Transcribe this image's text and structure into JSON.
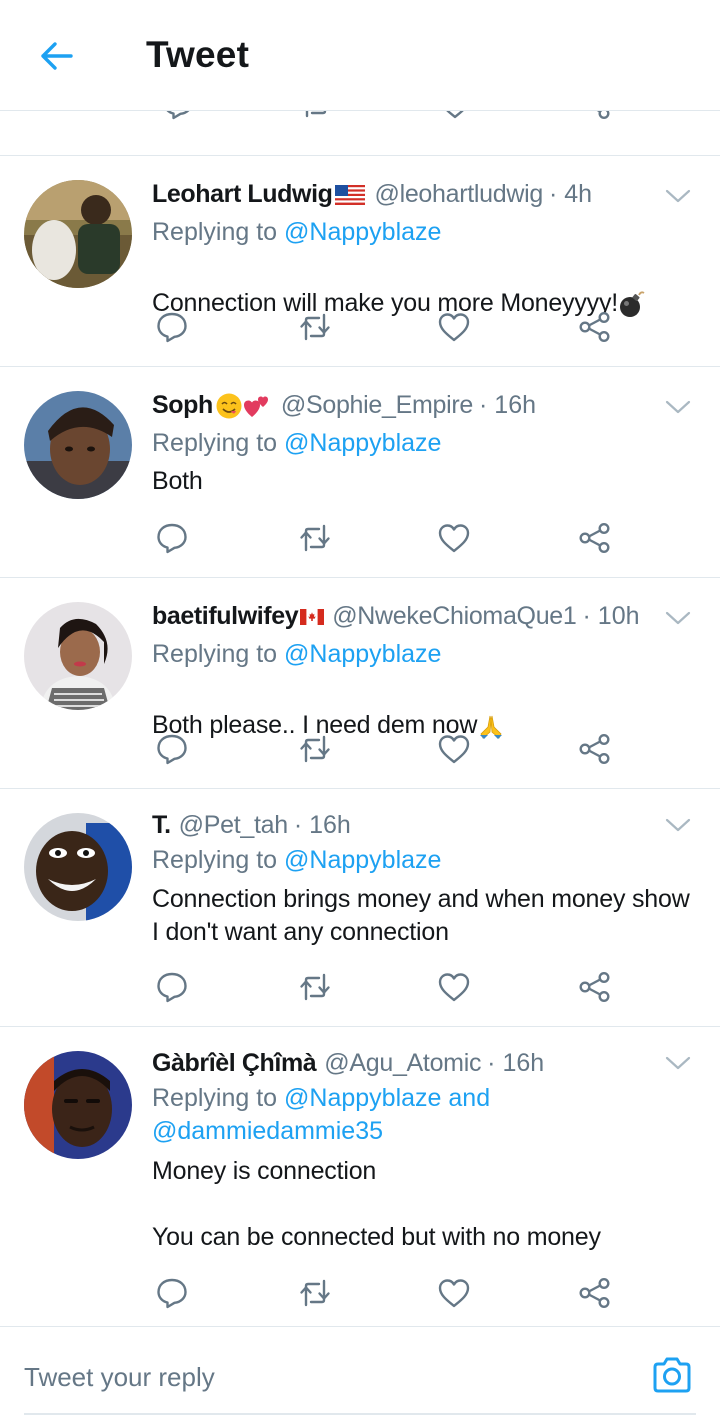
{
  "header": {
    "title": "Tweet",
    "back_icon": "arrow-left-icon"
  },
  "colors": {
    "accent": "#1da1f2",
    "secondary_text": "#657786",
    "divider": "#e1e8ed",
    "text": "#14171a"
  },
  "tweets": [
    {
      "name": "Leohart Ludwig",
      "name_icon": "us-flag",
      "handle": "@leohartludwig",
      "time": "· 4h",
      "replying_prefix": "Replying to ",
      "replying_to": "@Nappyblaze",
      "text": "Connection will make you more Moneyyyy!",
      "text_icon": "bomb-emoji"
    },
    {
      "name": "Soph",
      "name_icon": "yum-face-emoji two-hearts-emoji",
      "handle": "@Sophie_Empire",
      "time": "· 16h",
      "replying_prefix": "Replying to ",
      "replying_to": "@Nappyblaze",
      "text": "Both"
    },
    {
      "name": "baetifulwifey",
      "name_icon": "canada-flag",
      "handle": "@NwekeChiomaQue1",
      "time": "· 10h",
      "replying_prefix": "Replying to ",
      "replying_to": "@Nappyblaze",
      "text": "Both please.. I need dem now",
      "text_icon": "folded-hands-emoji"
    },
    {
      "name": "T.",
      "handle": "@Pet_tah",
      "time": "· 16h",
      "replying_prefix": "Replying to ",
      "replying_to": "@Nappyblaze",
      "text": "Connection brings money and when money show\nI don't want any connection"
    },
    {
      "name": "Gàbrîèl Çhîmà",
      "handle": "@Agu_Atomic",
      "time": "· 16h",
      "replying_prefix": "Replying to ",
      "replying_to": "@Nappyblaze and\n@dammiedammie35",
      "text": "Money is connection\n\nYou can be connected but with no money"
    }
  ],
  "actions": {
    "icons": [
      "reply-icon",
      "retweet-icon",
      "like-icon",
      "share-icon"
    ]
  },
  "reply_bar": {
    "placeholder": "Tweet your reply",
    "camera_icon": "camera-icon"
  }
}
